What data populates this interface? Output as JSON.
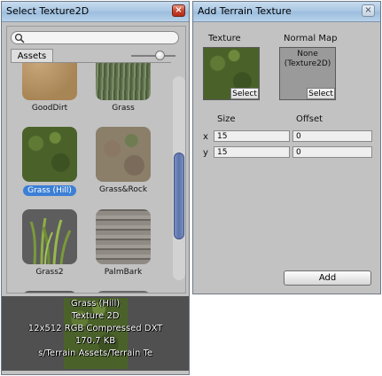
{
  "select_window": {
    "title": "Select Texture2D",
    "search_placeholder": "",
    "tab_label": "Assets",
    "items": [
      {
        "label": "GoodDirt",
        "texture": "dirt",
        "selected": false
      },
      {
        "label": "Grass",
        "texture": "tall-grass",
        "selected": false
      },
      {
        "label": "Grass (Hill)",
        "texture": "hill-grass",
        "selected": true
      },
      {
        "label": "Grass&Rock",
        "texture": "grass-rock",
        "selected": false
      },
      {
        "label": "Grass2",
        "texture": "grass-blades",
        "selected": false
      },
      {
        "label": "PalmBark",
        "texture": "palm-bark",
        "selected": false
      }
    ],
    "preview": {
      "name": "Grass (Hill)",
      "type": "Texture 2D",
      "info": "12x512  RGB Compressed DXT",
      "size": "170.7 KB",
      "path": "s/Terrain Assets/Terrain Te"
    }
  },
  "add_window": {
    "title": "Add Terrain Texture",
    "texture_label": "Texture",
    "normal_map_label": "Normal Map",
    "normal_map_value_line1": "None",
    "normal_map_value_line2": "(Texture2D)",
    "select_label": "Select",
    "size_label": "Size",
    "offset_label": "Offset",
    "x_label": "x",
    "y_label": "y",
    "size_x": "15",
    "size_y": "15",
    "offset_x": "0",
    "offset_y": "0",
    "add_button": "Add"
  },
  "colors": {
    "title_bar": "#aac8e4",
    "panel": "#c2c2c2",
    "selection": "#3b7fd6",
    "scroll_thumb": "#5a73ad"
  }
}
